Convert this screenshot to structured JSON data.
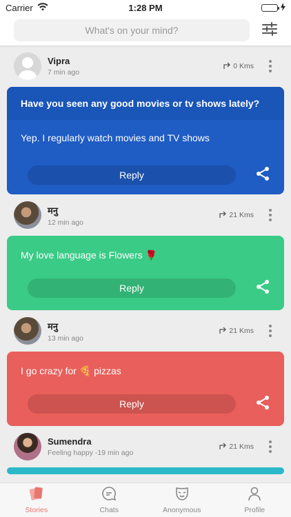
{
  "status_bar": {
    "carrier": "Carrier",
    "time": "1:28 PM"
  },
  "search": {
    "placeholder": "What's on your mind?"
  },
  "posts": [
    {
      "name": "Vipra",
      "time": "7 min ago",
      "distance": "0 Kms",
      "question": "Have you seen any good movies or tv shows lately?",
      "text": "Yep. I regularly watch movies and TV shows",
      "reply_label": "Reply",
      "color": "#1f5cc4"
    },
    {
      "name": "मनु",
      "time": "12 min ago",
      "distance": "21 Kms",
      "text": "My love language is Flowers 🌹",
      "reply_label": "Reply",
      "color": "#3acb86"
    },
    {
      "name": "मनु",
      "time": "13 min ago",
      "distance": "21 Kms",
      "text": "I go crazy for 🍕 pizzas",
      "reply_label": "Reply",
      "color": "#e95f5c"
    },
    {
      "name": "Sumendra",
      "time": "Feeling happy -19 min ago",
      "distance": "21 Kms",
      "color": "#2bb8c8"
    }
  ],
  "tabs": [
    {
      "label": "Stories",
      "icon": "stories-icon",
      "active": true
    },
    {
      "label": "Chats",
      "icon": "chat-icon",
      "active": false
    },
    {
      "label": "Anonymous",
      "icon": "mask-icon",
      "active": false
    },
    {
      "label": "Profile",
      "icon": "person-icon",
      "active": false
    }
  ],
  "colors": {
    "accent": "#e8766f",
    "blue_card": "#1f5cc4",
    "green_card": "#3acb86",
    "red_card": "#e95f5c"
  }
}
